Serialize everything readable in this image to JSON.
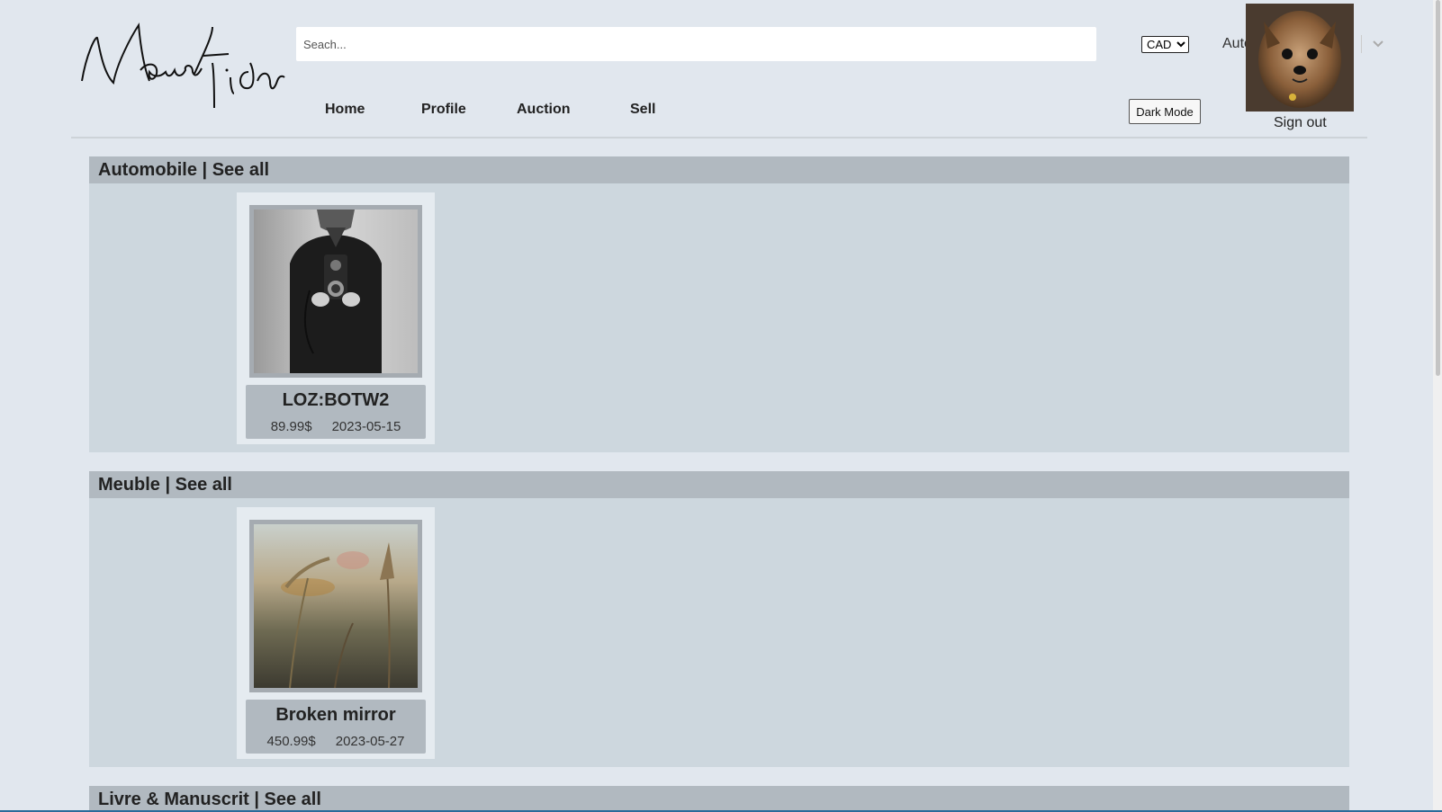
{
  "search": {
    "placeholder": "Seach...",
    "category": "Automobile"
  },
  "currency": {
    "selected": "CAD"
  },
  "nav": {
    "home": "Home",
    "profile": "Profile",
    "auction": "Auction",
    "sell": "Sell"
  },
  "dark_mode_label": "Dark Mode",
  "signout_label": "Sign out",
  "sections": [
    {
      "title": "Automobile | See all",
      "items": [
        {
          "title": "LOZ:BOTW2",
          "price": "89.99$",
          "date": "2023-05-15"
        }
      ]
    },
    {
      "title": "Meuble | See all",
      "items": [
        {
          "title": "Broken mirror",
          "price": "450.99$",
          "date": "2023-05-27"
        }
      ]
    },
    {
      "title": "Livre & Manuscrit | See all",
      "items": []
    }
  ],
  "colors": {
    "page_bg": "#e1e7ee",
    "section_header": "#b1b9c0",
    "section_body": "#cdd7de",
    "card_bg": "#e5ebf0"
  }
}
